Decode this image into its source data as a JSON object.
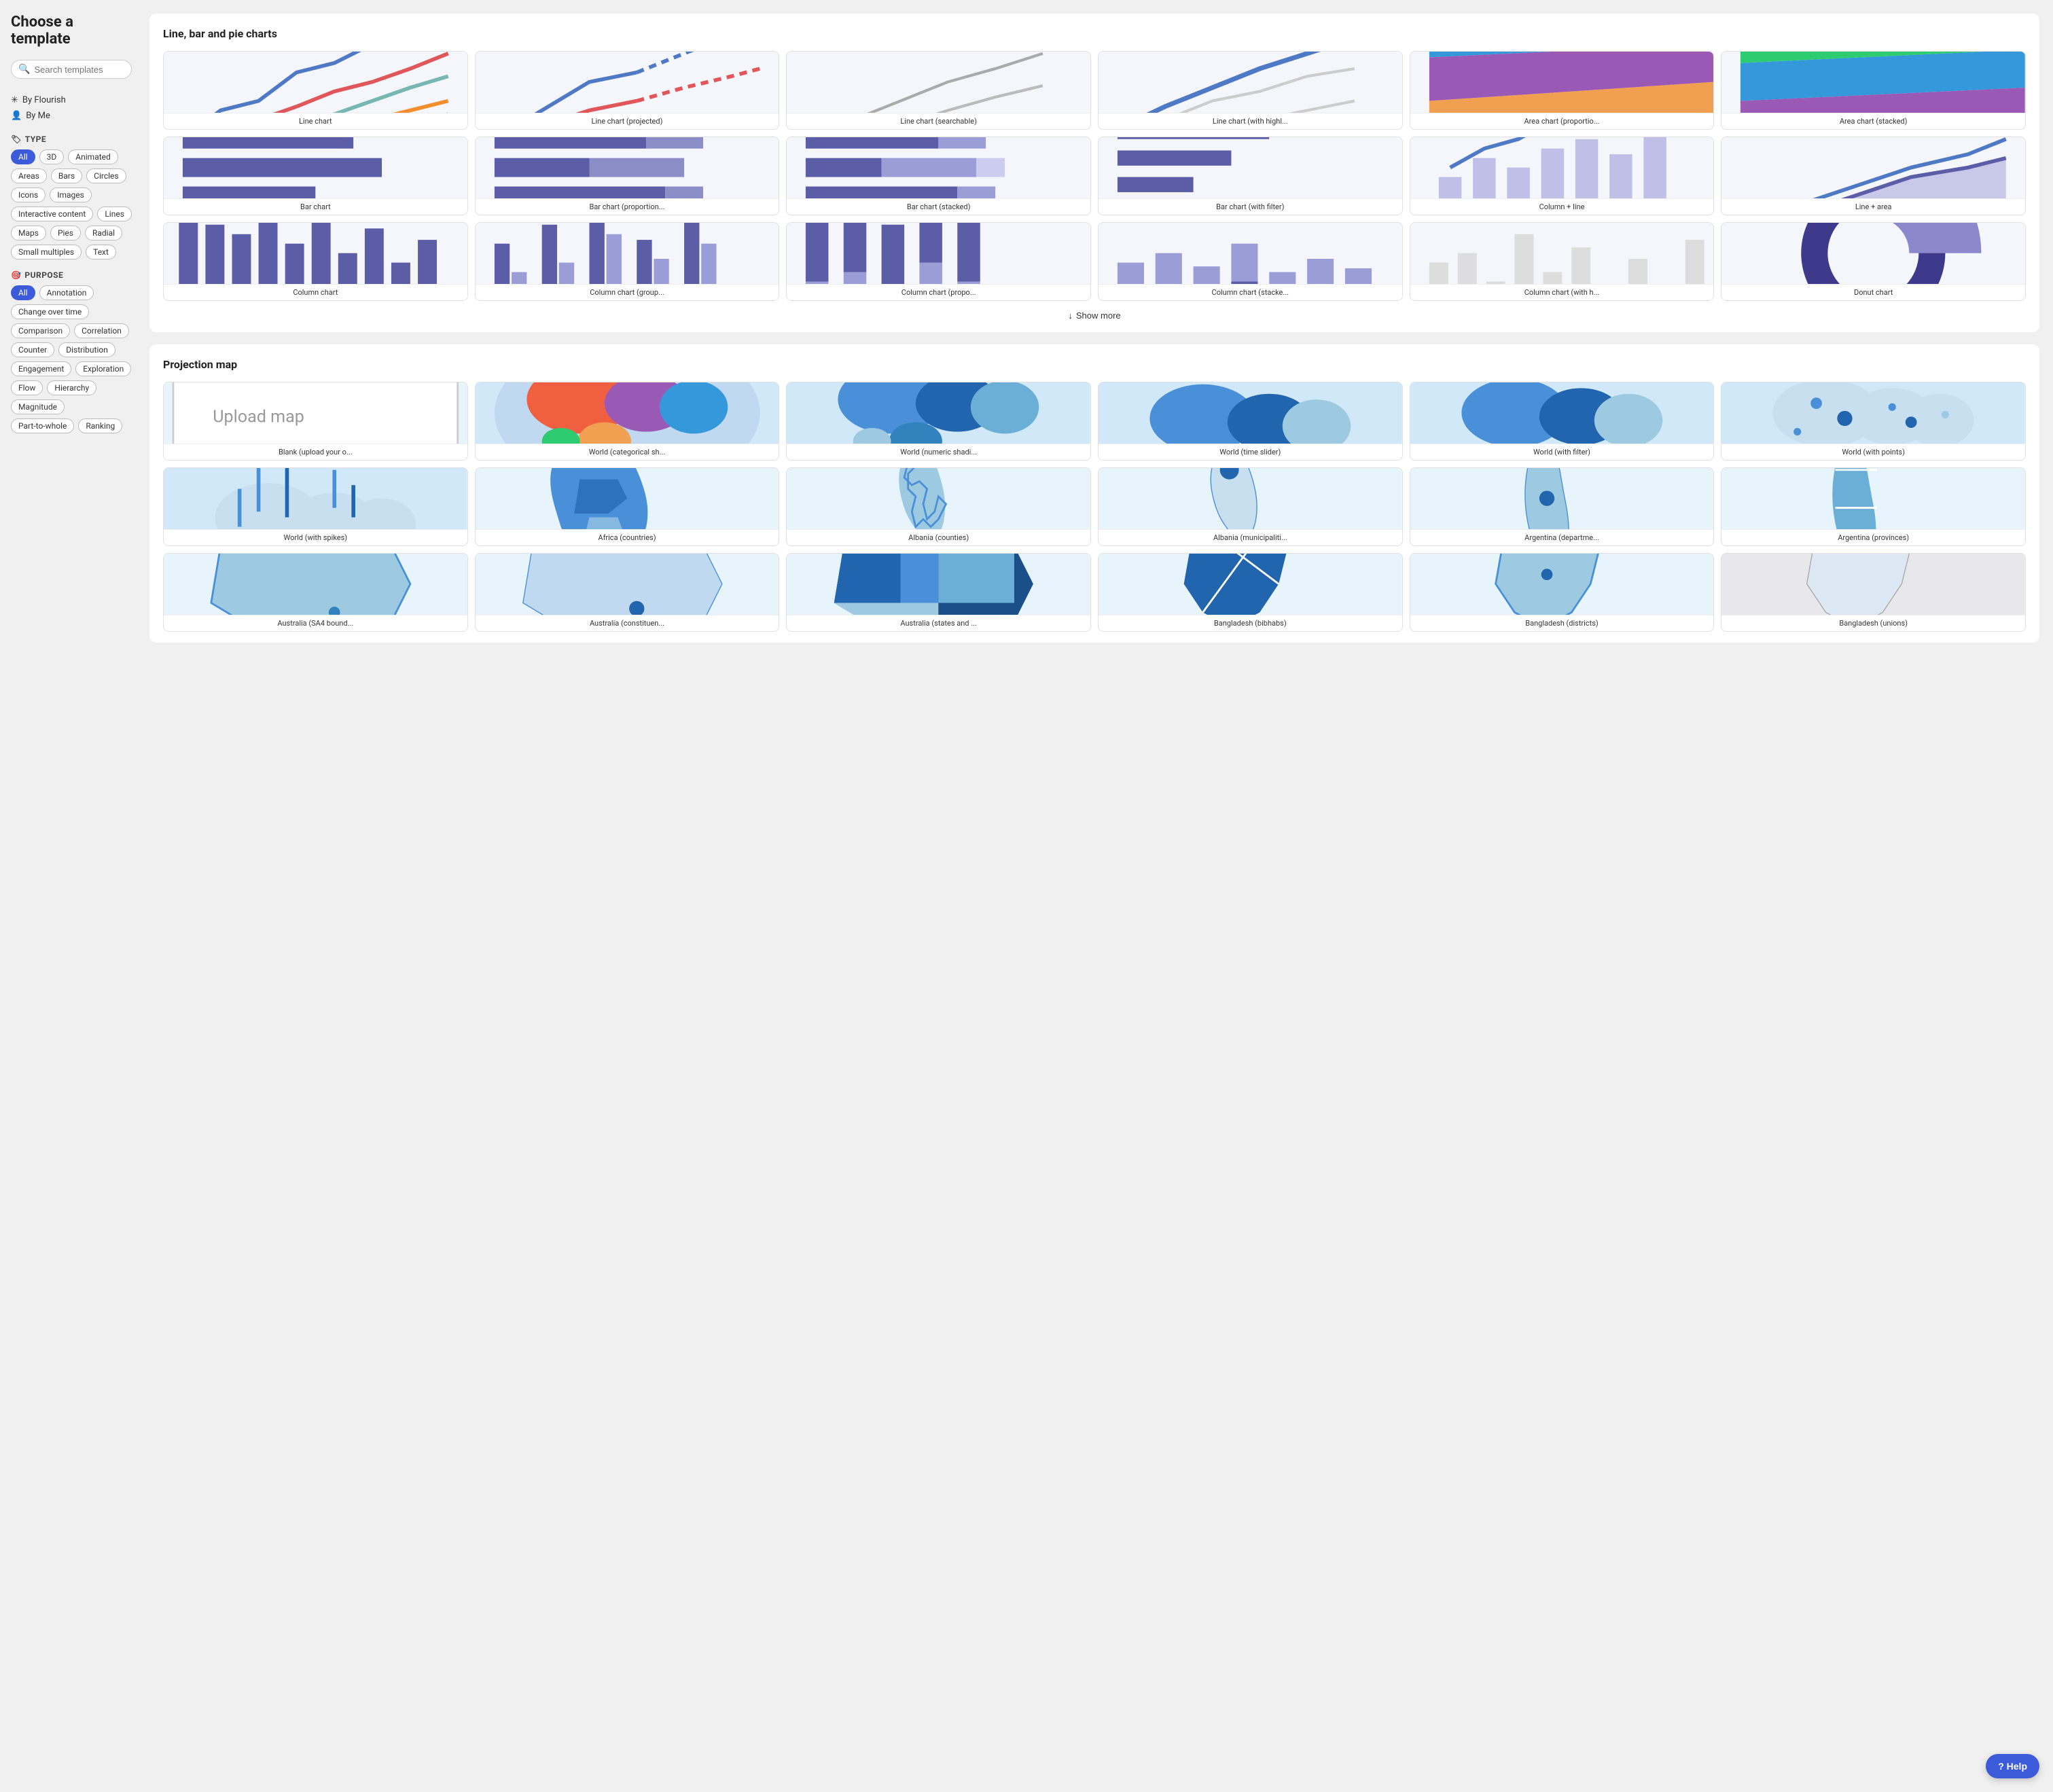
{
  "page": {
    "title": "Choose a template"
  },
  "search": {
    "placeholder": "Search templates"
  },
  "sidebar": {
    "byFlourish": "By Flourish",
    "byMe": "By Me",
    "typeSection": "Type",
    "purposeSection": "Purpose",
    "typeChips": [
      "All",
      "3D",
      "Animated",
      "Areas",
      "Bars",
      "Circles",
      "Icons",
      "Images",
      "Interactive content",
      "Lines",
      "Maps",
      "Pies",
      "Radial",
      "Small multiples",
      "Text"
    ],
    "purposeChips": [
      "All",
      "Annotation",
      "Change over time",
      "Comparison",
      "Correlation",
      "Counter",
      "Distribution",
      "Engagement",
      "Exploration",
      "Flow",
      "Hierarchy",
      "Magnitude",
      "Part-to-whole",
      "Ranking"
    ]
  },
  "sections": [
    {
      "id": "line-bar-pie",
      "title": "Line, bar and pie charts",
      "showMore": "Show more",
      "templates": [
        {
          "label": "Line chart",
          "type": "line"
        },
        {
          "label": "Line chart (projected)",
          "type": "line-projected"
        },
        {
          "label": "Line chart (searchable)",
          "type": "line-searchable"
        },
        {
          "label": "Line chart (with highl...",
          "type": "line-highlight"
        },
        {
          "label": "Area chart (proportio...",
          "type": "area-proportional"
        },
        {
          "label": "Area chart (stacked)",
          "type": "area-stacked"
        },
        {
          "label": "Bar chart",
          "type": "bar"
        },
        {
          "label": "Bar chart (proportion...",
          "type": "bar-proportion"
        },
        {
          "label": "Bar chart (stacked)",
          "type": "bar-stacked"
        },
        {
          "label": "Bar chart (with filter)",
          "type": "bar-filter"
        },
        {
          "label": "Column + line",
          "type": "column-line"
        },
        {
          "label": "Line + area",
          "type": "line-area"
        },
        {
          "label": "Column chart",
          "type": "column"
        },
        {
          "label": "Column chart (group...",
          "type": "column-group"
        },
        {
          "label": "Column chart (propo...",
          "type": "column-prop"
        },
        {
          "label": "Column chart (stacke...",
          "type": "column-stacked"
        },
        {
          "label": "Column chart (with h...",
          "type": "column-highlight"
        },
        {
          "label": "Donut chart",
          "type": "donut"
        }
      ]
    },
    {
      "id": "projection-map",
      "title": "Projection map",
      "showMore": "",
      "templates": [
        {
          "label": "Blank (upload your o...",
          "type": "map-blank"
        },
        {
          "label": "World (categorical sh...",
          "type": "map-world-cat"
        },
        {
          "label": "World (numeric shadi...",
          "type": "map-world-num"
        },
        {
          "label": "World (time slider)",
          "type": "map-world-time"
        },
        {
          "label": "World (with filter)",
          "type": "map-world-filter"
        },
        {
          "label": "World (with points)",
          "type": "map-world-points"
        },
        {
          "label": "World (with spikes)",
          "type": "map-world-spikes"
        },
        {
          "label": "Africa (countries)",
          "type": "map-africa"
        },
        {
          "label": "Albania (counties)",
          "type": "map-albania-counties"
        },
        {
          "label": "Albania (municipaliti...",
          "type": "map-albania-muni"
        },
        {
          "label": "Argentina (departme...",
          "type": "map-argentina-dept"
        },
        {
          "label": "Argentina (provinces)",
          "type": "map-argentina-prov"
        },
        {
          "label": "Australia (SA4 bound...",
          "type": "map-aus-sa4"
        },
        {
          "label": "Australia (constituen...",
          "type": "map-aus-const"
        },
        {
          "label": "Australia (states and ...",
          "type": "map-aus-states"
        },
        {
          "label": "Bangladesh (bibhabs)",
          "type": "map-bang-bib"
        },
        {
          "label": "Bangladesh (districts)",
          "type": "map-bang-dist"
        },
        {
          "label": "Bangladesh (unions)",
          "type": "map-bang-unions"
        }
      ]
    }
  ],
  "help": {
    "label": "? Help"
  },
  "icons": {
    "search": "🔍",
    "flourish": "✳",
    "user": "👤",
    "type": "🏷",
    "purpose": "🎯",
    "showMore": "↓"
  }
}
